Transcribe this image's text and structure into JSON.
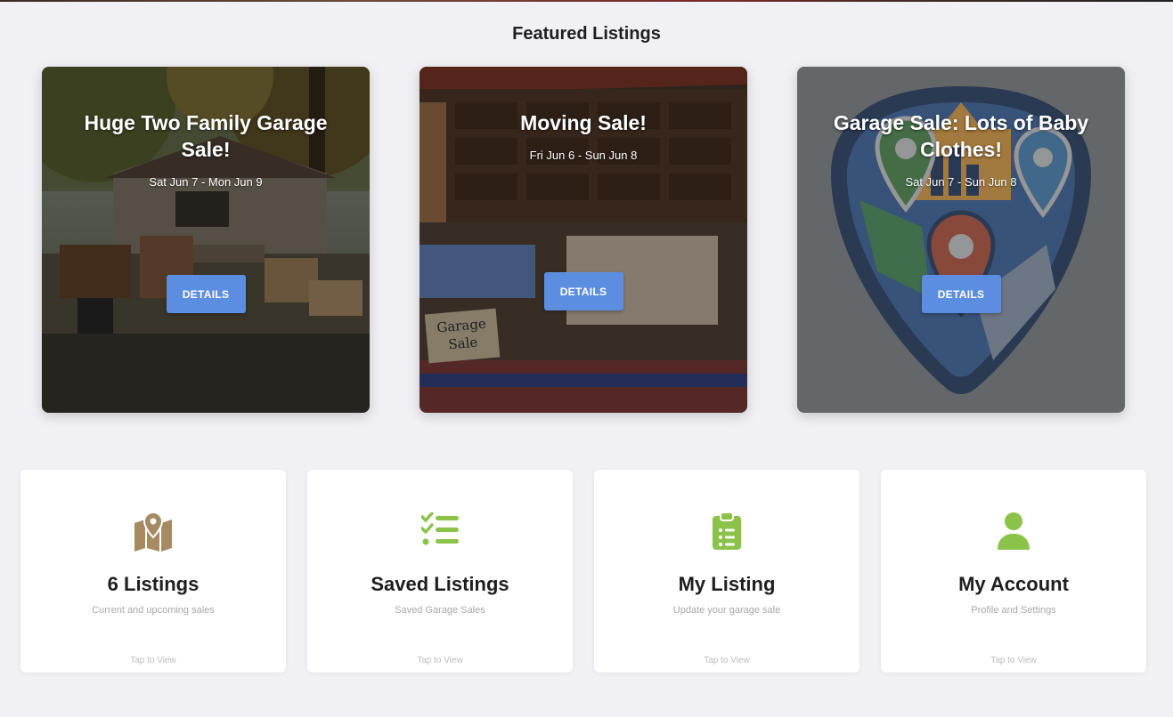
{
  "section_title": "Featured Listings",
  "featured": [
    {
      "title": "Huge Two Family Garage Sale!",
      "dates": "Sat Jun 7 - Mon Jun 9",
      "button": "DETAILS"
    },
    {
      "title": "Moving Sale!",
      "dates": "Fri Jun 6 - Sun Jun 8",
      "button": "DETAILS",
      "sign_text": "Garage Sale"
    },
    {
      "title": "Garage Sale: Lots of Baby Clothes!",
      "dates": "Sat Jun 7 - Sun Jun 8",
      "button": "DETAILS"
    }
  ],
  "nav_cards": [
    {
      "title": "6 Listings",
      "subtitle": "Current and upcoming sales",
      "tap": "Tap to View",
      "icon": "map-icon",
      "icon_color": "#a88a62"
    },
    {
      "title": "Saved Listings",
      "subtitle": "Saved Garage Sales",
      "tap": "Tap to View",
      "icon": "checklist-icon",
      "icon_color": "#8bc34a"
    },
    {
      "title": "My Listing",
      "subtitle": "Update your garage sale",
      "tap": "Tap to View",
      "icon": "clipboard-icon",
      "icon_color": "#8bc34a"
    },
    {
      "title": "My Account",
      "subtitle": "Profile and Settings",
      "tap": "Tap to View",
      "icon": "user-icon",
      "icon_color": "#8bc34a"
    }
  ],
  "colors": {
    "background": "#f1f1f5",
    "button": "#5b8ee0",
    "accent_green": "#8bc34a",
    "accent_tan": "#a88a62"
  }
}
